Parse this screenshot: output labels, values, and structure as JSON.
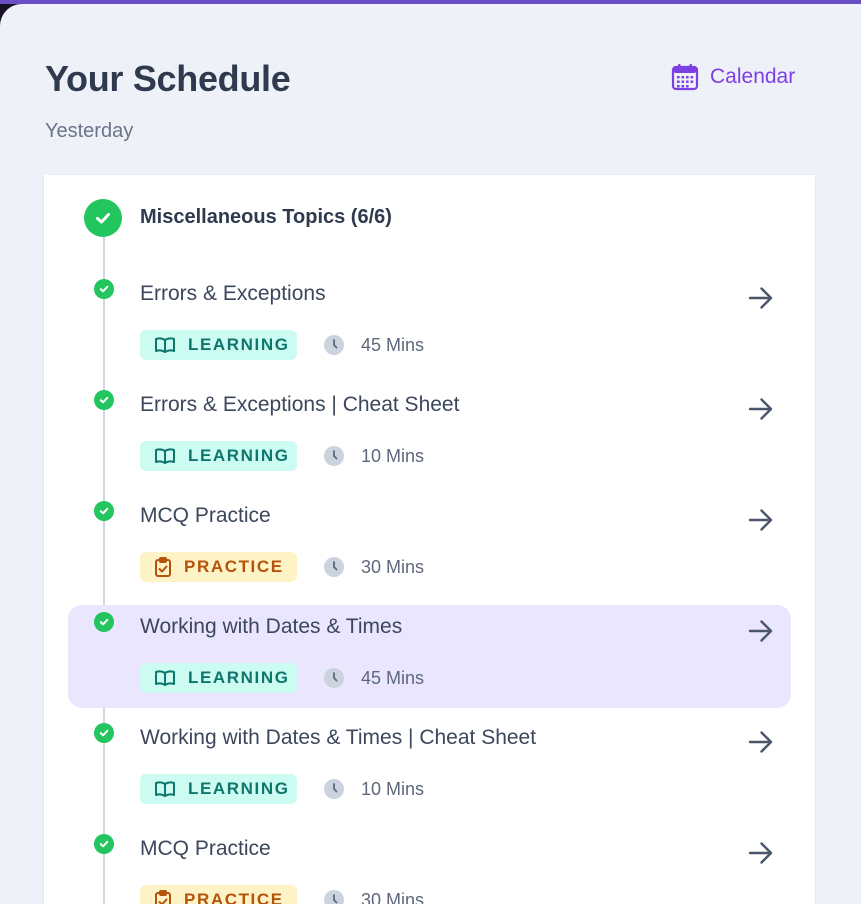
{
  "header": {
    "title": "Your Schedule",
    "subtitle": "Yesterday",
    "calendar_label": "Calendar"
  },
  "colors": {
    "accent": "#7b3fe4",
    "completed": "#22c55e",
    "learning_bg": "#ccfbf1",
    "learning_text": "#0f766e",
    "practice_bg": "#fef3c7",
    "practice_text": "#b45309",
    "active_row": "#e9e6fd"
  },
  "group": {
    "title": "Miscellaneous Topics (6/6)",
    "status": "completed",
    "items": [
      {
        "title": "Errors & Exceptions",
        "type": "LEARNING",
        "type_icon": "book-icon",
        "duration": "45 Mins",
        "status": "completed",
        "active": false
      },
      {
        "title": "Errors & Exceptions | Cheat Sheet",
        "type": "LEARNING",
        "type_icon": "book-icon",
        "duration": "10 Mins",
        "status": "completed",
        "active": false
      },
      {
        "title": "MCQ Practice",
        "type": "PRACTICE",
        "type_icon": "clipboard-icon",
        "duration": "30 Mins",
        "status": "completed",
        "active": false
      },
      {
        "title": "Working with Dates & Times",
        "type": "LEARNING",
        "type_icon": "book-icon",
        "duration": "45 Mins",
        "status": "completed",
        "active": true
      },
      {
        "title": "Working with Dates & Times | Cheat Sheet",
        "type": "LEARNING",
        "type_icon": "book-icon",
        "duration": "10 Mins",
        "status": "completed",
        "active": false
      },
      {
        "title": "MCQ Practice",
        "type": "PRACTICE",
        "type_icon": "clipboard-icon",
        "duration": "30 Mins",
        "status": "completed",
        "active": false
      }
    ]
  }
}
